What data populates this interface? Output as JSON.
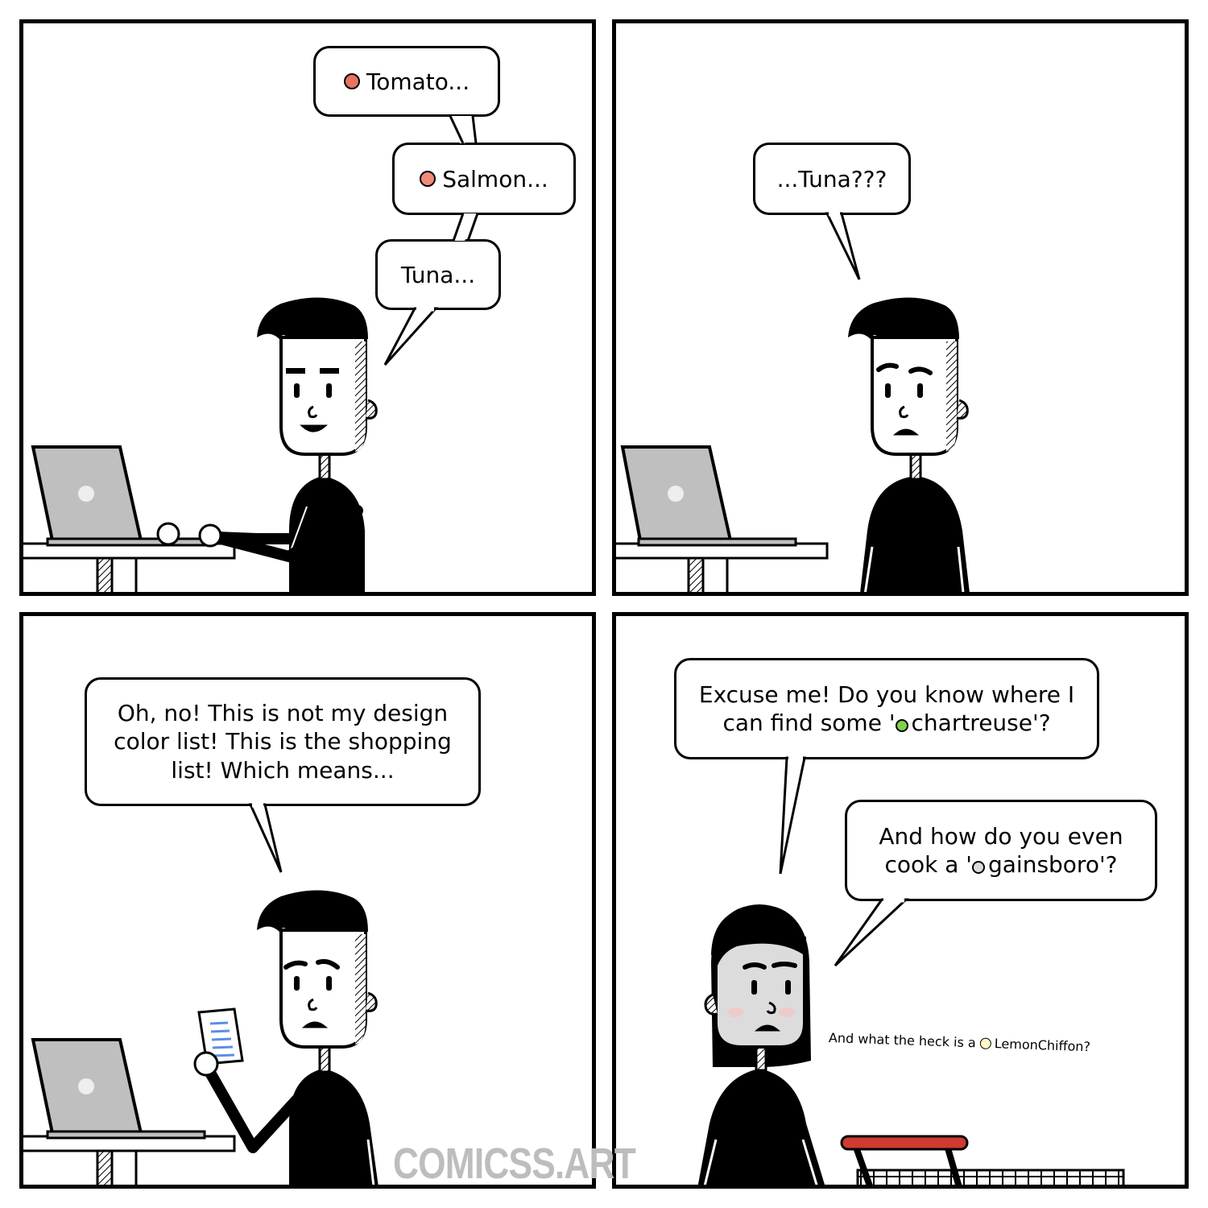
{
  "comic": {
    "panel1": {
      "bubble_tomato": {
        "color_dot": "#e8735f",
        "text": "Tomato..."
      },
      "bubble_salmon": {
        "color_dot": "#ee8b7a",
        "text": "Salmon..."
      },
      "bubble_tuna": {
        "text": "Tuna..."
      }
    },
    "panel2": {
      "bubble_tuna_question": {
        "text": "...Tuna???"
      }
    },
    "panel3": {
      "bubble": {
        "text": "Oh, no! This is not my design color list! This is the shopping list! Which means..."
      }
    },
    "panel4": {
      "bubble_excuse": {
        "text_before": "Excuse me! Do you know where I can find some '",
        "color_dot": "#7fd14a",
        "color_word": "chartreuse",
        "text_after": "'?"
      },
      "bubble_gainsboro": {
        "text_before": "And how do you even cook a '",
        "color_dot": "#dcdcdc",
        "color_word": "gainsboro",
        "text_after": "'?"
      },
      "whisper": {
        "text_before": "And what the heck is a",
        "color_dot": "#fff7c9",
        "color_word": "LemonChiffon?"
      }
    },
    "watermark": "COMICSS.ART"
  }
}
